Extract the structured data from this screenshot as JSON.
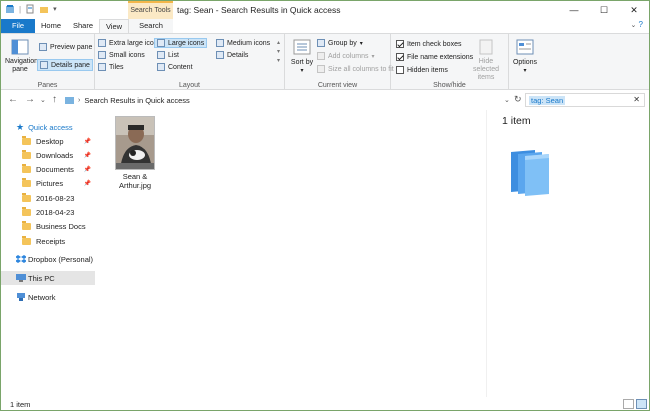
{
  "window": {
    "title": "tag: Sean - Search Results in Quick access",
    "context_tab_group": "Search Tools",
    "controls": {
      "minimize": "—",
      "maximize": "☐",
      "close": "✕"
    },
    "help_icon": "?"
  },
  "tabs": {
    "file": "File",
    "home": "Home",
    "share": "Share",
    "view": "View",
    "search": "Search"
  },
  "ribbon": {
    "panes": {
      "label": "Panes",
      "navigation_pane": "Navigation pane",
      "preview_pane": "Preview pane",
      "details_pane": "Details pane"
    },
    "layout": {
      "label": "Layout",
      "extra_large_icons": "Extra large icons",
      "large_icons": "Large icons",
      "medium_icons": "Medium icons",
      "small_icons": "Small icons",
      "list": "List",
      "details": "Details",
      "tiles": "Tiles",
      "content": "Content"
    },
    "current_view": {
      "label": "Current view",
      "sort_by": "Sort by",
      "group_by": "Group by",
      "add_columns": "Add columns",
      "size_all_columns": "Size all columns to fit"
    },
    "show_hide": {
      "label": "Show/hide",
      "item_check_boxes": "Item check boxes",
      "file_name_extensions": "File name extensions",
      "hidden_items": "Hidden items",
      "hide_selected_items": "Hide selected items",
      "item_check_boxes_on": true,
      "file_name_extensions_on": true,
      "hidden_items_on": false
    },
    "options": {
      "label": "Options"
    }
  },
  "address": {
    "path": "Search Results in Quick access",
    "search_query": "tag: Sean"
  },
  "nav": {
    "quick_access": "Quick access",
    "items": [
      {
        "label": "Desktop",
        "pinned": true
      },
      {
        "label": "Downloads",
        "pinned": true
      },
      {
        "label": "Documents",
        "pinned": true
      },
      {
        "label": "Pictures",
        "pinned": true
      },
      {
        "label": "2016-08-23",
        "pinned": false
      },
      {
        "label": "2018-04-23",
        "pinned": false
      },
      {
        "label": "Business Docs",
        "pinned": false
      },
      {
        "label": "Receipts",
        "pinned": false
      }
    ],
    "dropbox": "Dropbox (Personal)",
    "this_pc": "This PC",
    "network": "Network"
  },
  "content": {
    "file": {
      "name_line1": "Sean &",
      "name_line2": "Arthur.jpg"
    }
  },
  "preview": {
    "item_count": "1 item"
  },
  "status": {
    "text": "1 item"
  },
  "colors": {
    "accent": "#1979ca",
    "folder": "#f4c45a",
    "context_tab": "#fbe9c5"
  }
}
